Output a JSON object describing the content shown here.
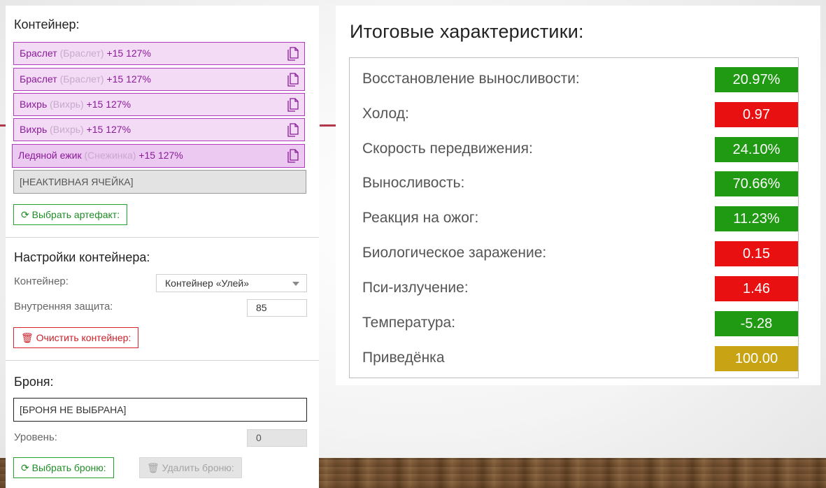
{
  "colors": {
    "green": "#1f9a12",
    "red": "#e81010",
    "gold": "#c8a414",
    "slot_border": "#b23ac0",
    "slot_bg": "#f3dbf5"
  },
  "container": {
    "title": "Контейнер:",
    "slots": [
      {
        "name": "Браслет",
        "sub": "(Браслет)",
        "bonus": "+15 127%",
        "icon": "copy-icon"
      },
      {
        "name": "Браслет",
        "sub": "(Браслет)",
        "bonus": "+15 127%",
        "icon": "copy-icon"
      },
      {
        "name": "Вихрь",
        "sub": "(Вихрь)",
        "bonus": "+15 127%",
        "icon": "copy-icon"
      },
      {
        "name": "Вихрь",
        "sub": "(Вихрь)",
        "bonus": "+15 127%",
        "icon": "copy-icon"
      },
      {
        "name": "Ледяной ежик",
        "sub": "(Снежинка)",
        "bonus": "+15 127%",
        "icon": "copy-icon"
      }
    ],
    "inactive_slot": "[НЕАКТИВНАЯ ЯЧЕЙКА]",
    "select_artifact_label": "Выбрать артефакт:"
  },
  "container_settings": {
    "title": "Настройки контейнера:",
    "container_label": "Контейнер:",
    "container_value": "Контейнер «Улей»",
    "inner_protection_label": "Внутренняя защита:",
    "inner_protection_value": "85",
    "clear_label": "Очистить контейнер:"
  },
  "armor": {
    "title": "Броня:",
    "field_value": "[БРОНЯ НЕ ВЫБРАНА]",
    "level_label": "Уровень:",
    "level_value": "0",
    "select_label": "Выбрать броню:",
    "remove_label": "Удалить броню:"
  },
  "summary": {
    "title": "Итоговые характеристики:",
    "stats": [
      {
        "label": "Восстановление выносливости:",
        "value": "20.97%",
        "color": "green"
      },
      {
        "label": "Холод:",
        "value": "0.97",
        "color": "red"
      },
      {
        "label": "Скорость передвижения:",
        "value": "24.10%",
        "color": "green"
      },
      {
        "label": "Выносливость:",
        "value": "70.66%",
        "color": "green"
      },
      {
        "label": "Реакция на ожог:",
        "value": "11.23%",
        "color": "green"
      },
      {
        "label": "Биологическое заражение:",
        "value": "0.15",
        "color": "red"
      },
      {
        "label": "Пси-излучение:",
        "value": "1.46",
        "color": "red"
      },
      {
        "label": "Температура:",
        "value": "-5.28",
        "color": "green"
      },
      {
        "label": "Приведёнка",
        "value": "100.00",
        "color": "gold"
      }
    ]
  }
}
